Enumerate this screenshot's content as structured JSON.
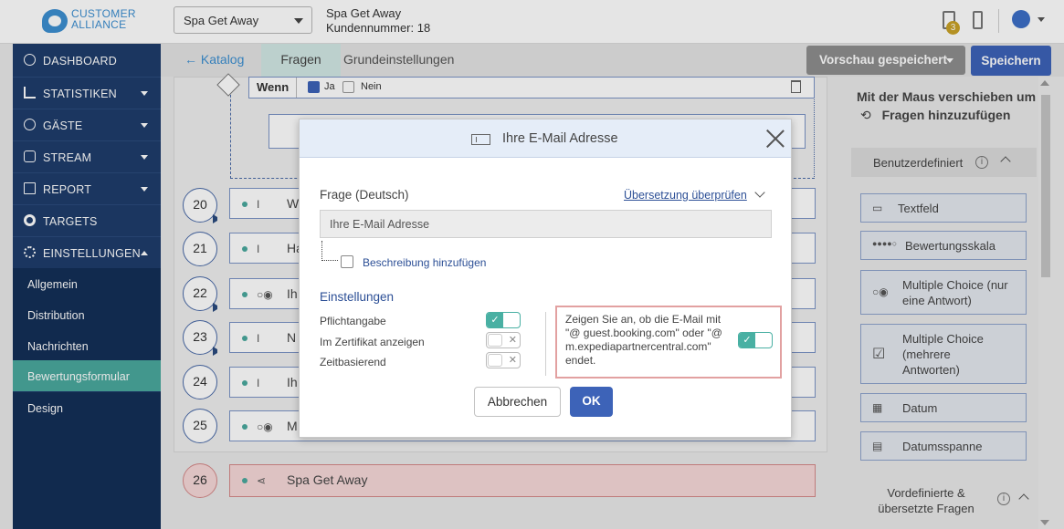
{
  "header": {
    "logo_line1": "CUSTOMER",
    "logo_line2": "ALLIANCE",
    "hotel_select": "Spa Get Away",
    "hotel_name": "Spa Get Away",
    "customer_number": "Kundennummer: 18",
    "notification_count": "3"
  },
  "sidebar": {
    "items": [
      {
        "label": "DASHBOARD"
      },
      {
        "label": "STATISTIKEN"
      },
      {
        "label": "GÄSTE"
      },
      {
        "label": "STREAM"
      },
      {
        "label": "REPORT"
      },
      {
        "label": "TARGETS"
      },
      {
        "label": "EINSTELLUNGEN"
      }
    ],
    "sub_items": [
      {
        "label": "Allgemein"
      },
      {
        "label": "Distribution"
      },
      {
        "label": "Nachrichten"
      },
      {
        "label": "Bewertungsformular"
      },
      {
        "label": "Design"
      }
    ]
  },
  "tabs": {
    "back": "← Katalog",
    "active": "Fragen",
    "other": "Grundeinstellungen"
  },
  "toolbar": {
    "preview_label": "Vorschau gespeichert",
    "save_label": "Speichern"
  },
  "condition": {
    "label": "Wenn",
    "yes": "Ja",
    "no": "Nein"
  },
  "questions": [
    {
      "num": "20",
      "icon": "I",
      "text": "W"
    },
    {
      "num": "21",
      "icon": "I",
      "text": "Ha"
    },
    {
      "num": "22",
      "icon": "○◉",
      "text": "Ih"
    },
    {
      "num": "23",
      "icon": "I",
      "text": "N"
    },
    {
      "num": "24",
      "icon": "I",
      "text": "Ih"
    },
    {
      "num": "25",
      "icon": "○◉",
      "text": "M"
    },
    {
      "num": "26",
      "icon": "⋖",
      "text": "Spa Get Away"
    }
  ],
  "right_panel": {
    "hint": "Mit der Maus verschieben um Fragen hinzuzufügen",
    "section_custom": "Benutzerdefiniert",
    "items": [
      {
        "icon": "▭",
        "label": "Textfeld"
      },
      {
        "icon": "●●●●○",
        "label": "Bewertungsskala"
      },
      {
        "icon": "○◉",
        "label": "Multiple Choice (nur eine Antwort)"
      },
      {
        "icon": "☑",
        "label": "Multiple Choice (mehrere Antworten)"
      },
      {
        "icon": "▦",
        "label": "Datum"
      },
      {
        "icon": "▤",
        "label": "Datumsspanne"
      }
    ],
    "section_predefined": "Vordefinierte & übersetzte Fragen"
  },
  "modal": {
    "title": "Ihre E-Mail Adresse",
    "question_label": "Frage (Deutsch)",
    "translation_link": "Übersetzung überprüfen",
    "question_value": "Ihre E-Mail Adresse",
    "add_description": "Beschreibung hinzufügen",
    "settings_title": "Einstellungen",
    "settings": [
      {
        "label": "Pflichtangabe",
        "on": true
      },
      {
        "label": "Im Zertifikat anzeigen",
        "on": false
      },
      {
        "label": "Zeitbasierend",
        "on": false
      }
    ],
    "email_notice": "Zeigen Sie an, ob die E-Mail mit \"@ guest.booking.com\" oder \"@ m.expediapartnercentral.com\" endet.",
    "cancel_label": "Abbrechen",
    "ok_label": "OK"
  },
  "colors": {
    "sidebar": "#1f3d6b",
    "accent_teal": "#49b0a3",
    "primary_blue": "#3d63b8",
    "highlight_red": "#e2a1a1"
  }
}
